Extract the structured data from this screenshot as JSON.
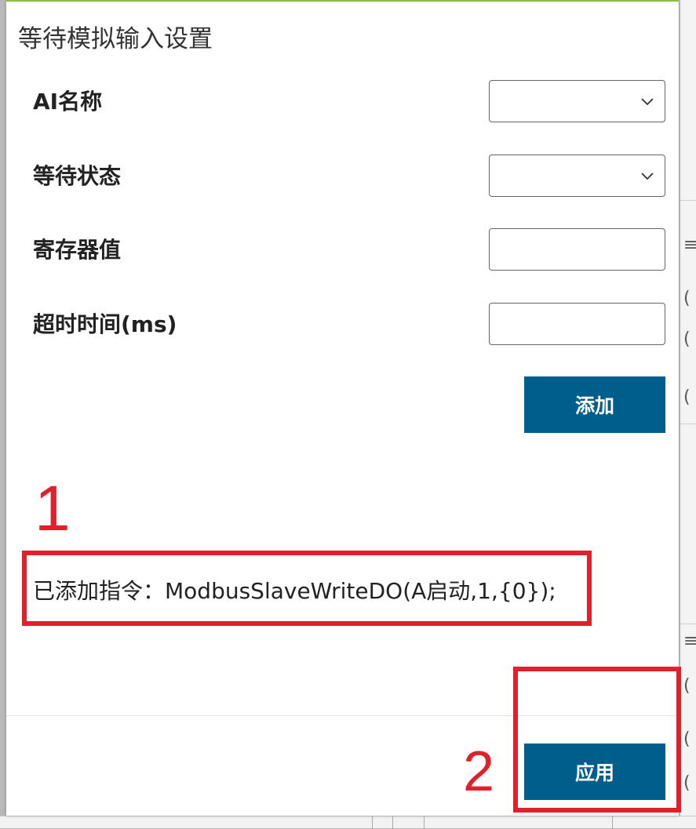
{
  "dialog": {
    "title": "等待模拟输入设置",
    "accent_color": "#8dbb47"
  },
  "form": {
    "fields": [
      {
        "label": "AI名称",
        "type": "select",
        "value": ""
      },
      {
        "label": "等待状态",
        "type": "select",
        "value": ""
      },
      {
        "label": "寄存器值",
        "type": "text",
        "value": ""
      },
      {
        "label": "超时时间(ms)",
        "type": "text",
        "value": ""
      }
    ],
    "add_label": "添加"
  },
  "command": {
    "text": "已添加指令：ModbusSlaveWriteDO(A启动,1,{0});"
  },
  "footer": {
    "apply_label": "应用"
  },
  "annotations": {
    "marker_1": "1",
    "marker_2": "2",
    "color": "#e0202a"
  },
  "colors": {
    "primary_button": "#005e8c"
  },
  "icons": {
    "select_arrow": "chevron-down-icon"
  }
}
